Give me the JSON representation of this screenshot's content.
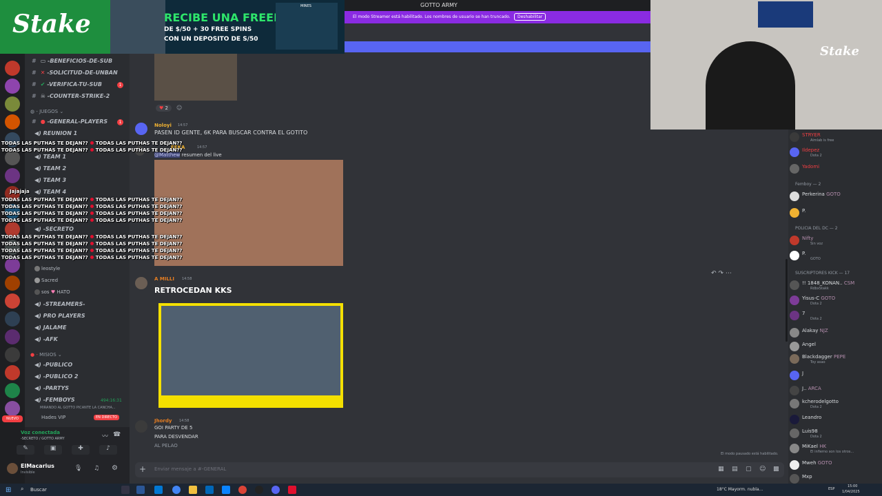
{
  "title_bar": {
    "title": "GOTTO ARMY"
  },
  "ad": {
    "brand": "Stake",
    "headline": "RECIBE UNA FREEBET",
    "sub1": "DE $/50 + 30 FREE SPINS",
    "sub2": "CON UN DEPOSITO DE S/50",
    "game": "MINES"
  },
  "streamer_bar": {
    "text": "El modo Streamer está habilitado. Los nombres de usuario se han truncado.",
    "button": "Deshabilitar"
  },
  "rail_badges": [
    "17",
    "33",
    "58",
    "1",
    "80",
    "347",
    "2",
    "360",
    "16",
    "38",
    "NUEVO",
    "72"
  ],
  "sidebar": {
    "channels_top": [
      {
        "icon": "tv-icon",
        "label": "-BENEFICIOS-DE-SUB"
      },
      {
        "icon": "x-icon",
        "label": "-SOLICITUD-DE-UNBAN"
      },
      {
        "icon": "check-icon",
        "label": "-VERIFICA-TU-SUB",
        "badge": "1"
      },
      {
        "icon": "skull-icon",
        "label": "-COUNTER-STRIKE-2"
      }
    ],
    "cat_juegos": "JUEGOS",
    "general_players": "-GENERAL-PLAYERS",
    "general_badge": "1",
    "voice_juegos": [
      "REUNION 1",
      "TEAM 1",
      "TEAM 2",
      "TEAM 3",
      "TEAM 4"
    ],
    "secreto": "-SECRETO",
    "secreto_users": [
      "leostyle",
      "Sacred",
      "sos"
    ],
    "hato_tag": "HATO",
    "voice_mid": [
      "-STREAMERS-",
      "PRO PLAYERS",
      "JALAME",
      "-AFK"
    ],
    "cat_misios": "MISIOS",
    "voice_misios": [
      "-PUBLICO",
      "-PUBLICO 2",
      "-PARTYS",
      "-FEMBOYS"
    ],
    "femboys_timer": "494:16:31",
    "femboys_sub": "MIRANDO AL GOTTO PICANTE LA CANCHA...",
    "femboys_user": "Hades",
    "vip_tag": "VIP",
    "live_tag": "EN DIRECTO",
    "voice_status": "Voz conectada",
    "voice_channel": "-SECRETO / GOTTO ARMY",
    "user_name": "ElMacarius",
    "user_status": "Invisible"
  },
  "messages": {
    "reactions": [
      "2"
    ],
    "m1_author": "Noloyi",
    "m1_time": "14:57",
    "m1_text": "PASEN ID GENTE, 6K PARA BUSCAR CONTRA EL GOTITO",
    "m2_author": "FEKA",
    "m2_time": "14:57",
    "m2_mention": "@Matthew",
    "m2_text": "resumen del live",
    "m3_author": "A MILLI",
    "m3_time": "14:58",
    "m3_text": "RETROCEDAN KKS",
    "m4_author": "Jhordy",
    "m4_time": "14:58",
    "m4_lines": [
      "GOI PARTY DE 5",
      "PARA DESVENDAR",
      "AL PELAO"
    ],
    "input_placeholder": "Enviar mensaje a #-GENERAL",
    "paused_text": "El modo pausado está habilitado."
  },
  "overlay": {
    "line": "TODAS LAS PUTHAS TE DEJAN??",
    "jajaja": "Jajajaja"
  },
  "members": {
    "top": [
      {
        "name": "STRYER",
        "sub": "Aimlab is free",
        "color": "#f23f43"
      },
      {
        "name": "Ildepez",
        "sub": "Dota 2",
        "color": "#f23f43"
      },
      {
        "name": "Yadomi",
        "sub": "",
        "color": "#f23f43"
      }
    ],
    "cat_femboy": "Femboy — 2",
    "femboy": [
      {
        "name": "Perkerina",
        "tag": "GOTO"
      },
      {
        "name": "P.",
        "tag": ""
      }
    ],
    "cat_policia": "POLICIA DEL DC — 2",
    "policia": [
      {
        "name": "Nifty",
        "sub": "Sin voz"
      },
      {
        "name": "P.",
        "sub": "GOTO"
      }
    ],
    "cat_subs": "SUSCRIPTORES KICK — 17",
    "subs": [
      {
        "name": "!! 1848_KONAN..",
        "tag": "CSM",
        "sub": "RdbxStakk"
      },
      {
        "name": "Yisus-C",
        "tag": "GOTO",
        "sub": "Dota 2"
      },
      {
        "name": "7",
        "tag": "",
        "sub": "Dota 2"
      },
      {
        "name": "Alakay",
        "tag": "NJZ",
        "sub": ""
      },
      {
        "name": "Angel",
        "tag": "",
        "sub": ""
      },
      {
        "name": "Blackdagger",
        "tag": "PEPE",
        "sub": "Toy asao"
      },
      {
        "name": "J",
        "tag": "",
        "sub": ""
      },
      {
        "name": "J..",
        "tag": "ARCA",
        "sub": ""
      },
      {
        "name": "kcherodelgotto",
        "tag": "",
        "sub": "Dota 2"
      },
      {
        "name": "Leandro",
        "tag": "",
        "sub": ""
      },
      {
        "name": "Luis98",
        "tag": "",
        "sub": "Dota 2"
      },
      {
        "name": "MiKael",
        "tag": "HK",
        "sub": "El infierno son los otros..."
      },
      {
        "name": "Mweh",
        "tag": "GOTO",
        "sub": ""
      },
      {
        "name": "Mxp",
        "tag": "",
        "sub": ""
      }
    ]
  },
  "taskbar": {
    "search": "Buscar",
    "weather": "18°C  Mayorm. nubla...",
    "lang": "ESP",
    "time": "15:00",
    "date": "1/04/2025"
  }
}
